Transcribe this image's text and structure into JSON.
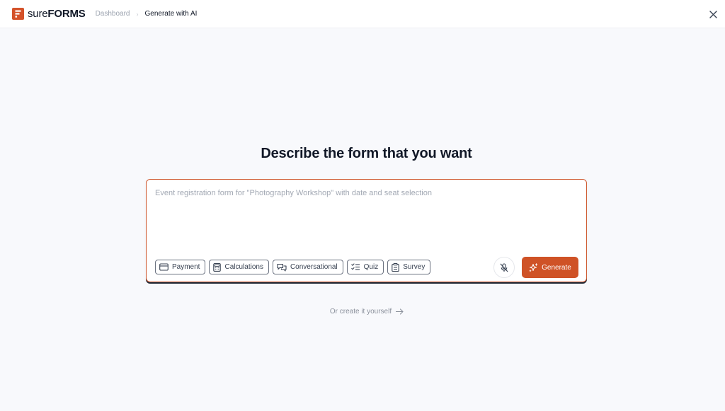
{
  "header": {
    "logo_sure": "sure",
    "logo_forms": "FORMS",
    "breadcrumb": [
      {
        "label": "Dashboard"
      },
      {
        "label": "Generate with AI"
      }
    ]
  },
  "main": {
    "title": "Describe the form that you want",
    "prompt_placeholder": "Event registration form for \"Photography Workshop\" with date and seat selection",
    "chips": [
      {
        "label": "Payment",
        "icon": "credit-card-icon"
      },
      {
        "label": "Calculations",
        "icon": "calculator-icon"
      },
      {
        "label": "Conversational",
        "icon": "chat-bubbles-icon"
      },
      {
        "label": "Quiz",
        "icon": "checklist-icon"
      },
      {
        "label": "Survey",
        "icon": "clipboard-icon"
      }
    ],
    "mic_icon": "mic-off-icon",
    "generate_label": "Generate",
    "generate_icon": "sparkles-icon",
    "alt_link": "Or create it yourself"
  },
  "colors": {
    "brand": "#d4522a",
    "generate_bg": "#cf5226",
    "card_border": "#cf5a32",
    "background": "#f8f9fc"
  }
}
